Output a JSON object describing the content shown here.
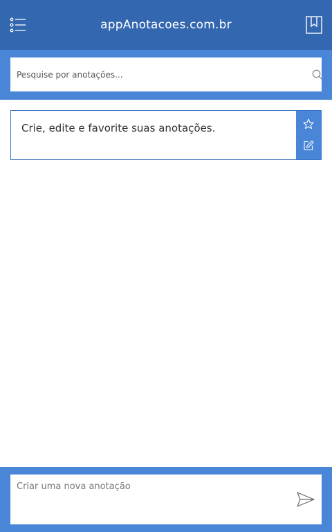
{
  "header": {
    "title": "appAnotacoes.com.br",
    "menu_icon": "list-menu-icon",
    "bookmark_icon": "bookmark-icon"
  },
  "search": {
    "placeholder": "Pesquise por anotações...",
    "value": "",
    "icon": "search-icon"
  },
  "notes": [
    {
      "text": "Crie, edite e favorite suas anotações.",
      "actions": [
        "star-icon",
        "edit-icon"
      ]
    }
  ],
  "composer": {
    "placeholder": "Criar uma nova anotação",
    "value": "",
    "send_icon": "send-icon"
  },
  "colors": {
    "header": "#3367b0",
    "accent": "#4a86d8",
    "card_border": "#3a72c4"
  }
}
